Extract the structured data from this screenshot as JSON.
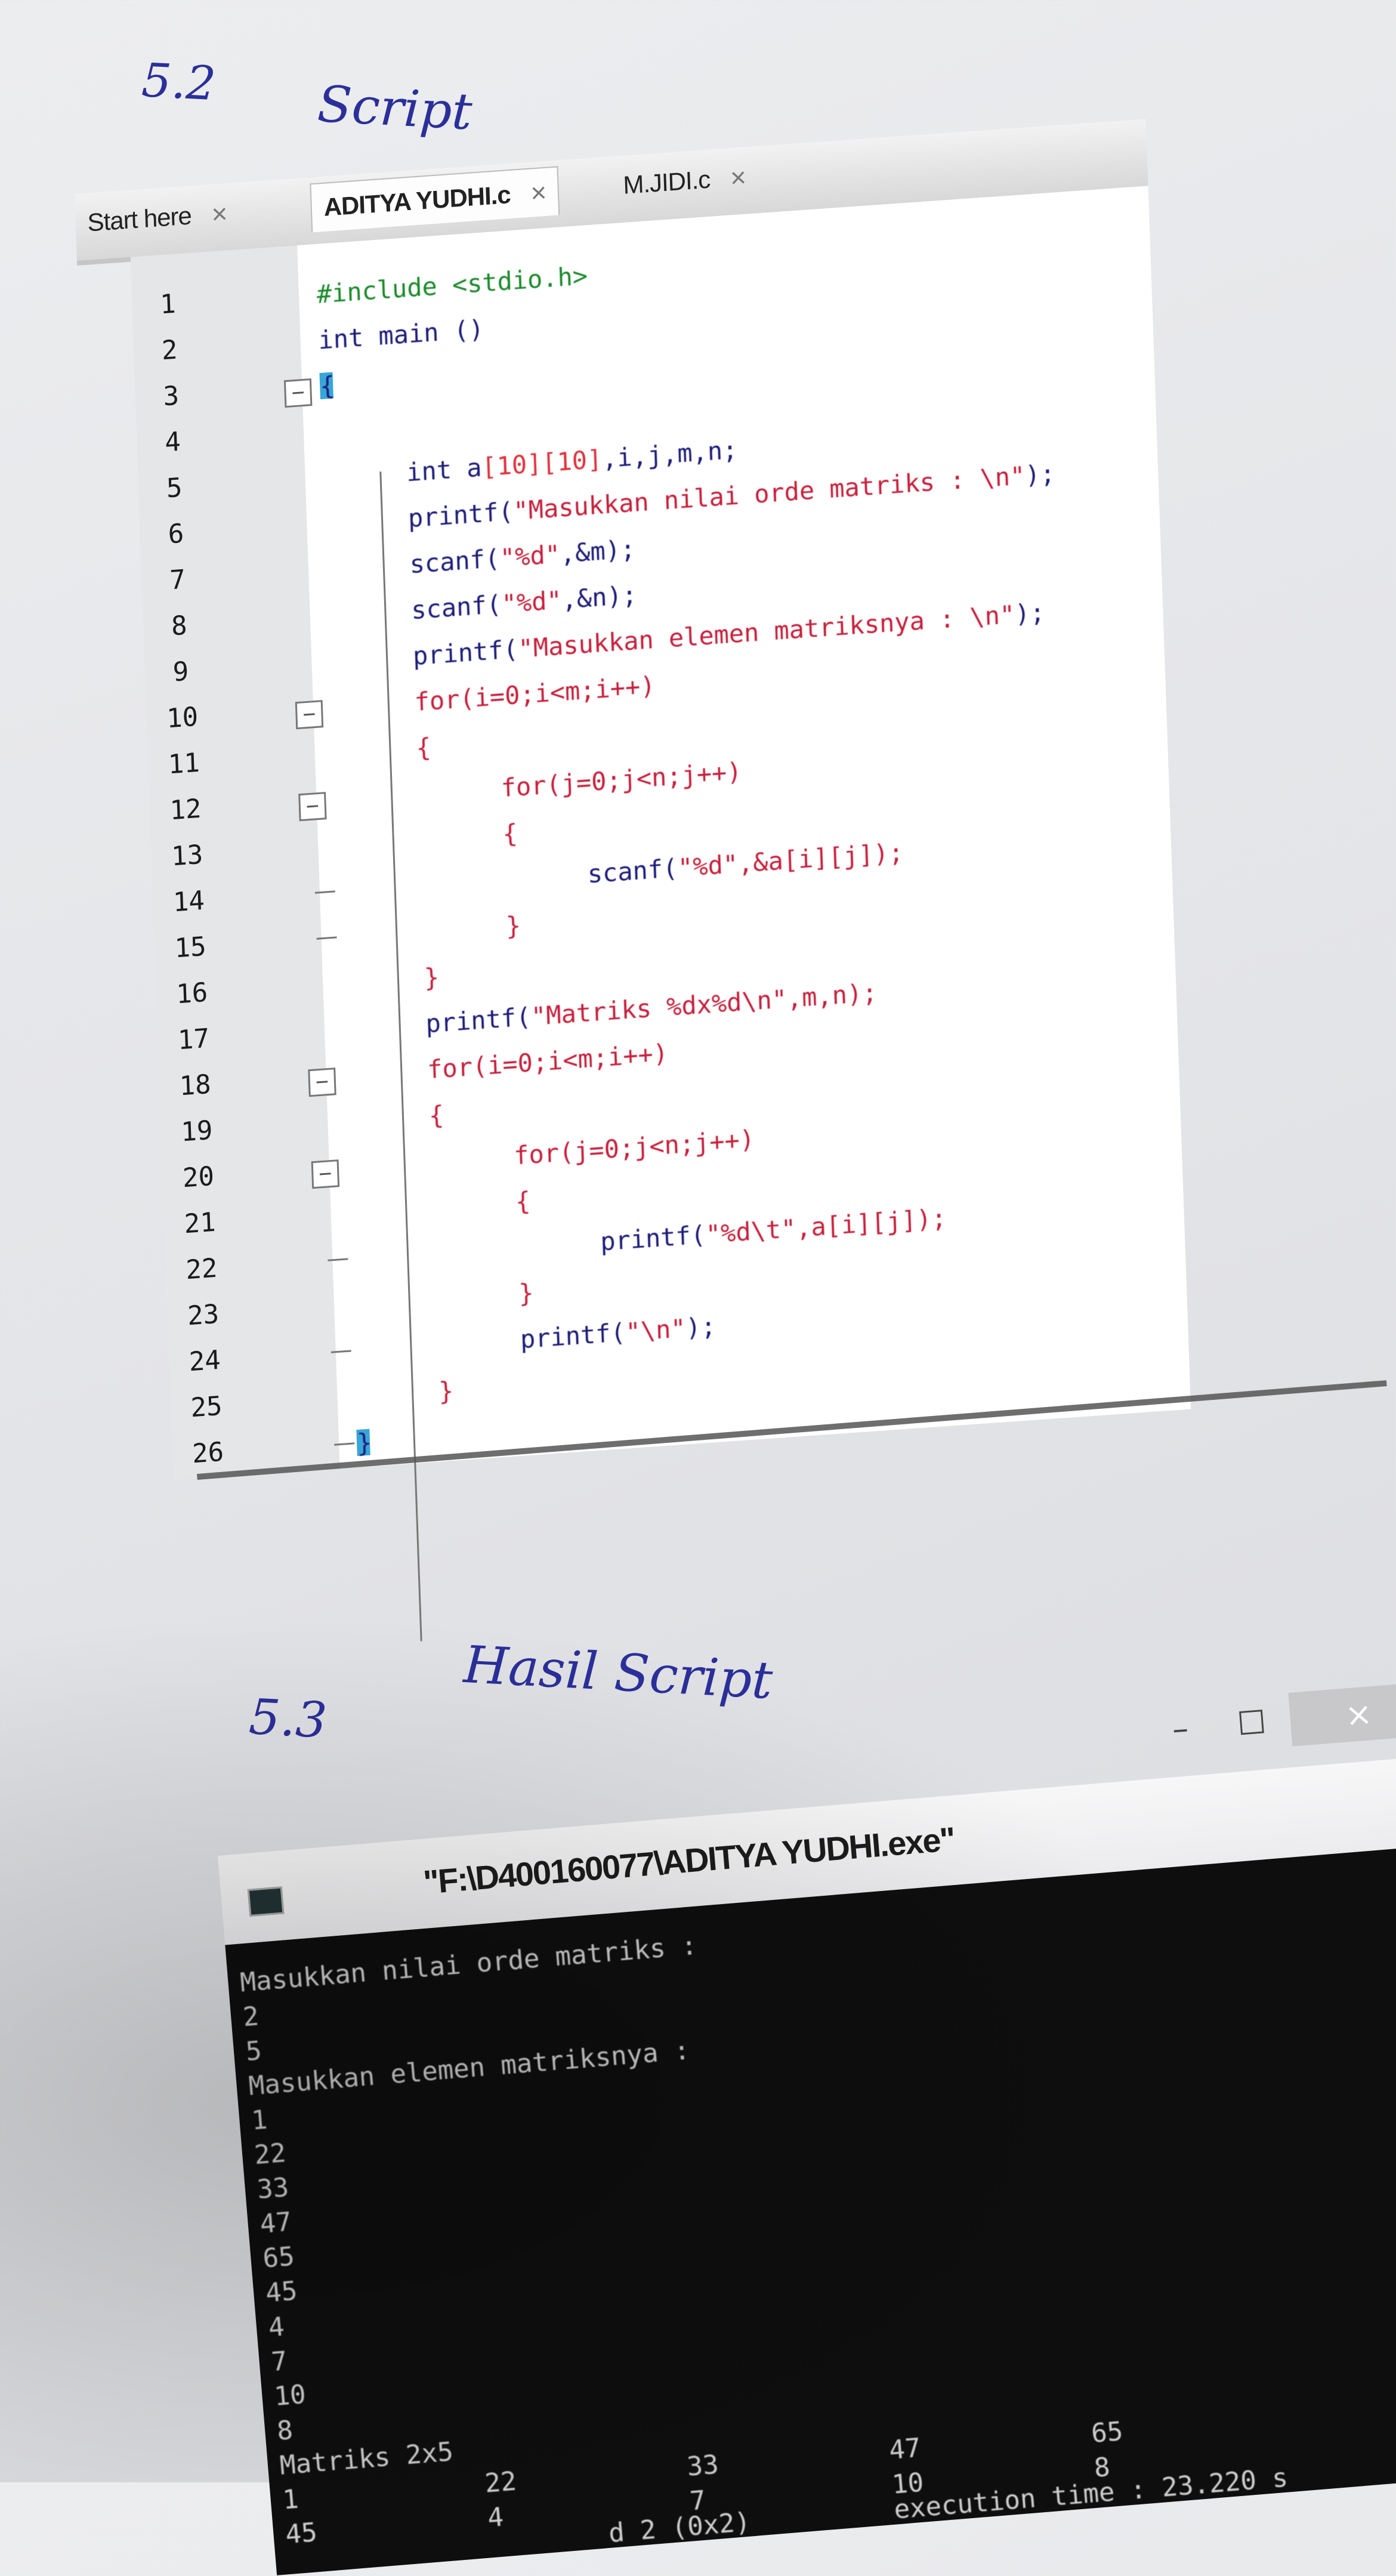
{
  "notes": {
    "section_52_number": "5.2",
    "section_52_title": "Script",
    "section_53_number": "5.3",
    "section_53_title": "Hasil Script"
  },
  "editor": {
    "tabs": [
      {
        "label": "Start here",
        "close": "×"
      },
      {
        "label": "ADITYA YUDHI.c",
        "close": "×"
      },
      {
        "label": "M.JIDI.c",
        "close": "×"
      }
    ],
    "line_numbers": [
      "1",
      "2",
      "3",
      "4",
      "5",
      "6",
      "7",
      "8",
      "9",
      "10",
      "11",
      "12",
      "13",
      "14",
      "15",
      "16",
      "17",
      "18",
      "19",
      "20",
      "21",
      "22",
      "23",
      "24",
      "25",
      "26"
    ],
    "code": {
      "l1": "#include <stdio.h>",
      "l2": "int main ()",
      "l3": "{",
      "l5a": "int a",
      "l5b": "[10][10]",
      "l5c": ",i,j,m,n;",
      "l6a": "printf(",
      "l6b": "\"Masukkan nilai orde matriks : \\n\"",
      "l6c": ");",
      "l7a": "scanf(",
      "l7b": "\"%d\"",
      "l7c": ",&m);",
      "l8a": "scanf(",
      "l8b": "\"%d\"",
      "l8c": ",&n);",
      "l9a": "printf(",
      "l9b": "\"Masukkan elemen matriksnya : \\n\"",
      "l9c": ");",
      "l10": "for(i=0;i<m;i++)",
      "l11": "{",
      "l12": "for(j=0;j<n;j++)",
      "l13": "{",
      "l14a": "scanf(",
      "l14b": "\"%d\"",
      "l14c": ",&a[i][j]);",
      "l15": "}",
      "l16": "}",
      "l17a": "printf(",
      "l17b": "\"Matriks %dx%d\\n\"",
      "l17c": ",m,n);",
      "l18": "for(i=0;i<m;i++)",
      "l19": "{",
      "l20": "for(j=0;j<n;j++)",
      "l21": "{",
      "l22a": "printf(",
      "l22b": "\"%d\\t\"",
      "l22c": ",a[i][j]);",
      "l23": "}",
      "l24a": "printf(",
      "l24b": "\"\\n\"",
      "l24c": ");",
      "l25": "}",
      "l26": "}"
    }
  },
  "console": {
    "title": "\"F:\\D400160077\\ADITYA YUDHI.exe\"",
    "window_buttons": {
      "minimize": "–",
      "maximize": "☐",
      "close": "×"
    },
    "lines": [
      "Masukkan nilai orde matriks :",
      "2",
      "5",
      "Masukkan elemen matriksnya :",
      "1",
      "22",
      "33",
      "47",
      "65",
      "45",
      "4",
      "7",
      "10",
      "8"
    ],
    "matrix_header": "Matriks 2x5",
    "row1": [
      "1",
      "22",
      "33",
      "47",
      "65"
    ],
    "row2": [
      "45",
      "4",
      "7",
      "10",
      "8"
    ],
    "footer_left": "d 2 (0x2)",
    "footer_right": "execution time : 23.220 s"
  },
  "colors": {
    "handwriting": "#2b2f9a",
    "preprocessor": "#1a8a2a",
    "string": "#c81e3a",
    "keyword": "#1c1c7a",
    "terminal_bg": "#0e0e0e",
    "cursor": "#38a6d8"
  }
}
